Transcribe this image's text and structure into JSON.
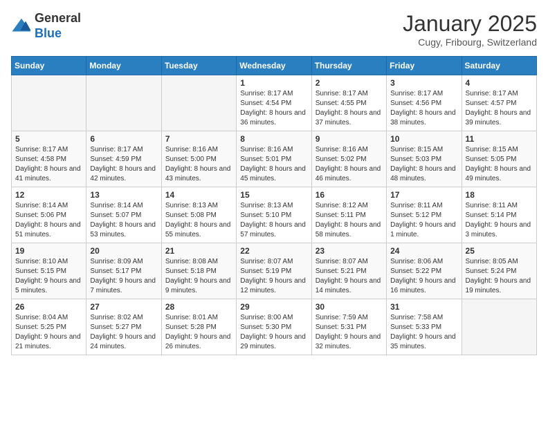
{
  "header": {
    "logo_general": "General",
    "logo_blue": "Blue",
    "month_title": "January 2025",
    "location": "Cugy, Fribourg, Switzerland"
  },
  "days_of_week": [
    "Sunday",
    "Monday",
    "Tuesday",
    "Wednesday",
    "Thursday",
    "Friday",
    "Saturday"
  ],
  "weeks": [
    {
      "days": [
        {
          "empty": true
        },
        {
          "empty": true
        },
        {
          "empty": true
        },
        {
          "num": "1",
          "sunrise": "8:17 AM",
          "sunset": "4:54 PM",
          "daylight": "8 hours and 36 minutes."
        },
        {
          "num": "2",
          "sunrise": "8:17 AM",
          "sunset": "4:55 PM",
          "daylight": "8 hours and 37 minutes."
        },
        {
          "num": "3",
          "sunrise": "8:17 AM",
          "sunset": "4:56 PM",
          "daylight": "8 hours and 38 minutes."
        },
        {
          "num": "4",
          "sunrise": "8:17 AM",
          "sunset": "4:57 PM",
          "daylight": "8 hours and 39 minutes."
        }
      ]
    },
    {
      "days": [
        {
          "num": "5",
          "sunrise": "8:17 AM",
          "sunset": "4:58 PM",
          "daylight": "8 hours and 41 minutes."
        },
        {
          "num": "6",
          "sunrise": "8:17 AM",
          "sunset": "4:59 PM",
          "daylight": "8 hours and 42 minutes."
        },
        {
          "num": "7",
          "sunrise": "8:16 AM",
          "sunset": "5:00 PM",
          "daylight": "8 hours and 43 minutes."
        },
        {
          "num": "8",
          "sunrise": "8:16 AM",
          "sunset": "5:01 PM",
          "daylight": "8 hours and 45 minutes."
        },
        {
          "num": "9",
          "sunrise": "8:16 AM",
          "sunset": "5:02 PM",
          "daylight": "8 hours and 46 minutes."
        },
        {
          "num": "10",
          "sunrise": "8:15 AM",
          "sunset": "5:03 PM",
          "daylight": "8 hours and 48 minutes."
        },
        {
          "num": "11",
          "sunrise": "8:15 AM",
          "sunset": "5:05 PM",
          "daylight": "8 hours and 49 minutes."
        }
      ]
    },
    {
      "days": [
        {
          "num": "12",
          "sunrise": "8:14 AM",
          "sunset": "5:06 PM",
          "daylight": "8 hours and 51 minutes."
        },
        {
          "num": "13",
          "sunrise": "8:14 AM",
          "sunset": "5:07 PM",
          "daylight": "8 hours and 53 minutes."
        },
        {
          "num": "14",
          "sunrise": "8:13 AM",
          "sunset": "5:08 PM",
          "daylight": "8 hours and 55 minutes."
        },
        {
          "num": "15",
          "sunrise": "8:13 AM",
          "sunset": "5:10 PM",
          "daylight": "8 hours and 57 minutes."
        },
        {
          "num": "16",
          "sunrise": "8:12 AM",
          "sunset": "5:11 PM",
          "daylight": "8 hours and 58 minutes."
        },
        {
          "num": "17",
          "sunrise": "8:11 AM",
          "sunset": "5:12 PM",
          "daylight": "9 hours and 1 minute."
        },
        {
          "num": "18",
          "sunrise": "8:11 AM",
          "sunset": "5:14 PM",
          "daylight": "9 hours and 3 minutes."
        }
      ]
    },
    {
      "days": [
        {
          "num": "19",
          "sunrise": "8:10 AM",
          "sunset": "5:15 PM",
          "daylight": "9 hours and 5 minutes."
        },
        {
          "num": "20",
          "sunrise": "8:09 AM",
          "sunset": "5:17 PM",
          "daylight": "9 hours and 7 minutes."
        },
        {
          "num": "21",
          "sunrise": "8:08 AM",
          "sunset": "5:18 PM",
          "daylight": "9 hours and 9 minutes."
        },
        {
          "num": "22",
          "sunrise": "8:07 AM",
          "sunset": "5:19 PM",
          "daylight": "9 hours and 12 minutes."
        },
        {
          "num": "23",
          "sunrise": "8:07 AM",
          "sunset": "5:21 PM",
          "daylight": "9 hours and 14 minutes."
        },
        {
          "num": "24",
          "sunrise": "8:06 AM",
          "sunset": "5:22 PM",
          "daylight": "9 hours and 16 minutes."
        },
        {
          "num": "25",
          "sunrise": "8:05 AM",
          "sunset": "5:24 PM",
          "daylight": "9 hours and 19 minutes."
        }
      ]
    },
    {
      "days": [
        {
          "num": "26",
          "sunrise": "8:04 AM",
          "sunset": "5:25 PM",
          "daylight": "9 hours and 21 minutes."
        },
        {
          "num": "27",
          "sunrise": "8:02 AM",
          "sunset": "5:27 PM",
          "daylight": "9 hours and 24 minutes."
        },
        {
          "num": "28",
          "sunrise": "8:01 AM",
          "sunset": "5:28 PM",
          "daylight": "9 hours and 26 minutes."
        },
        {
          "num": "29",
          "sunrise": "8:00 AM",
          "sunset": "5:30 PM",
          "daylight": "9 hours and 29 minutes."
        },
        {
          "num": "30",
          "sunrise": "7:59 AM",
          "sunset": "5:31 PM",
          "daylight": "9 hours and 32 minutes."
        },
        {
          "num": "31",
          "sunrise": "7:58 AM",
          "sunset": "5:33 PM",
          "daylight": "9 hours and 35 minutes."
        },
        {
          "empty": true
        }
      ]
    }
  ],
  "labels": {
    "sunrise": "Sunrise:",
    "sunset": "Sunset:",
    "daylight": "Daylight:"
  }
}
